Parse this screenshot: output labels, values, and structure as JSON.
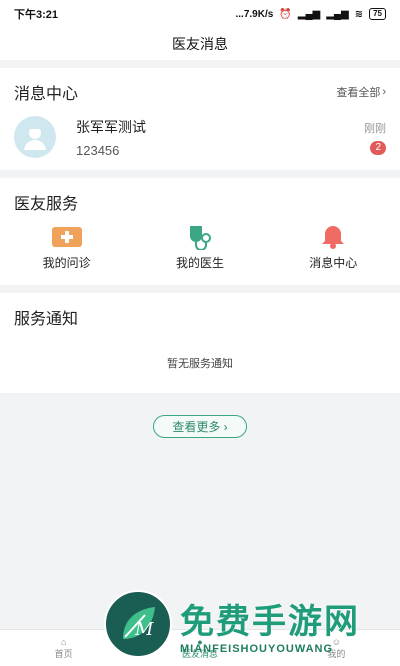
{
  "status": {
    "time": "下午3:21",
    "speed": "...7.9K/s",
    "battery": "75"
  },
  "header": {
    "title": "医友消息"
  },
  "messages": {
    "section_title": "消息中心",
    "view_all": "查看全部",
    "items": [
      {
        "name": "张军军测试",
        "subtitle": "123456",
        "time": "刚刚",
        "badge": "2"
      }
    ]
  },
  "services": {
    "section_title": "医友服务",
    "items": [
      {
        "label": "我的问诊",
        "icon": "plus-card-icon",
        "color": "#f0a15a"
      },
      {
        "label": "我的医生",
        "icon": "stethoscope-icon",
        "color": "#3aa686"
      },
      {
        "label": "消息中心",
        "icon": "bell-icon",
        "color": "#ef6b63"
      }
    ]
  },
  "notices": {
    "section_title": "服务通知",
    "empty_text": "暂无服务通知"
  },
  "more_button": "查看更多",
  "tabbar": {
    "items": [
      {
        "label": "首页"
      },
      {
        "label": "医友消息"
      },
      {
        "label": "我的"
      }
    ]
  },
  "watermark": {
    "cn": "免费手游网",
    "en": "MIANFEISHOUYOUWANG"
  },
  "colors": {
    "accent": "#2e8b6e",
    "badge": "#e25b5b"
  }
}
